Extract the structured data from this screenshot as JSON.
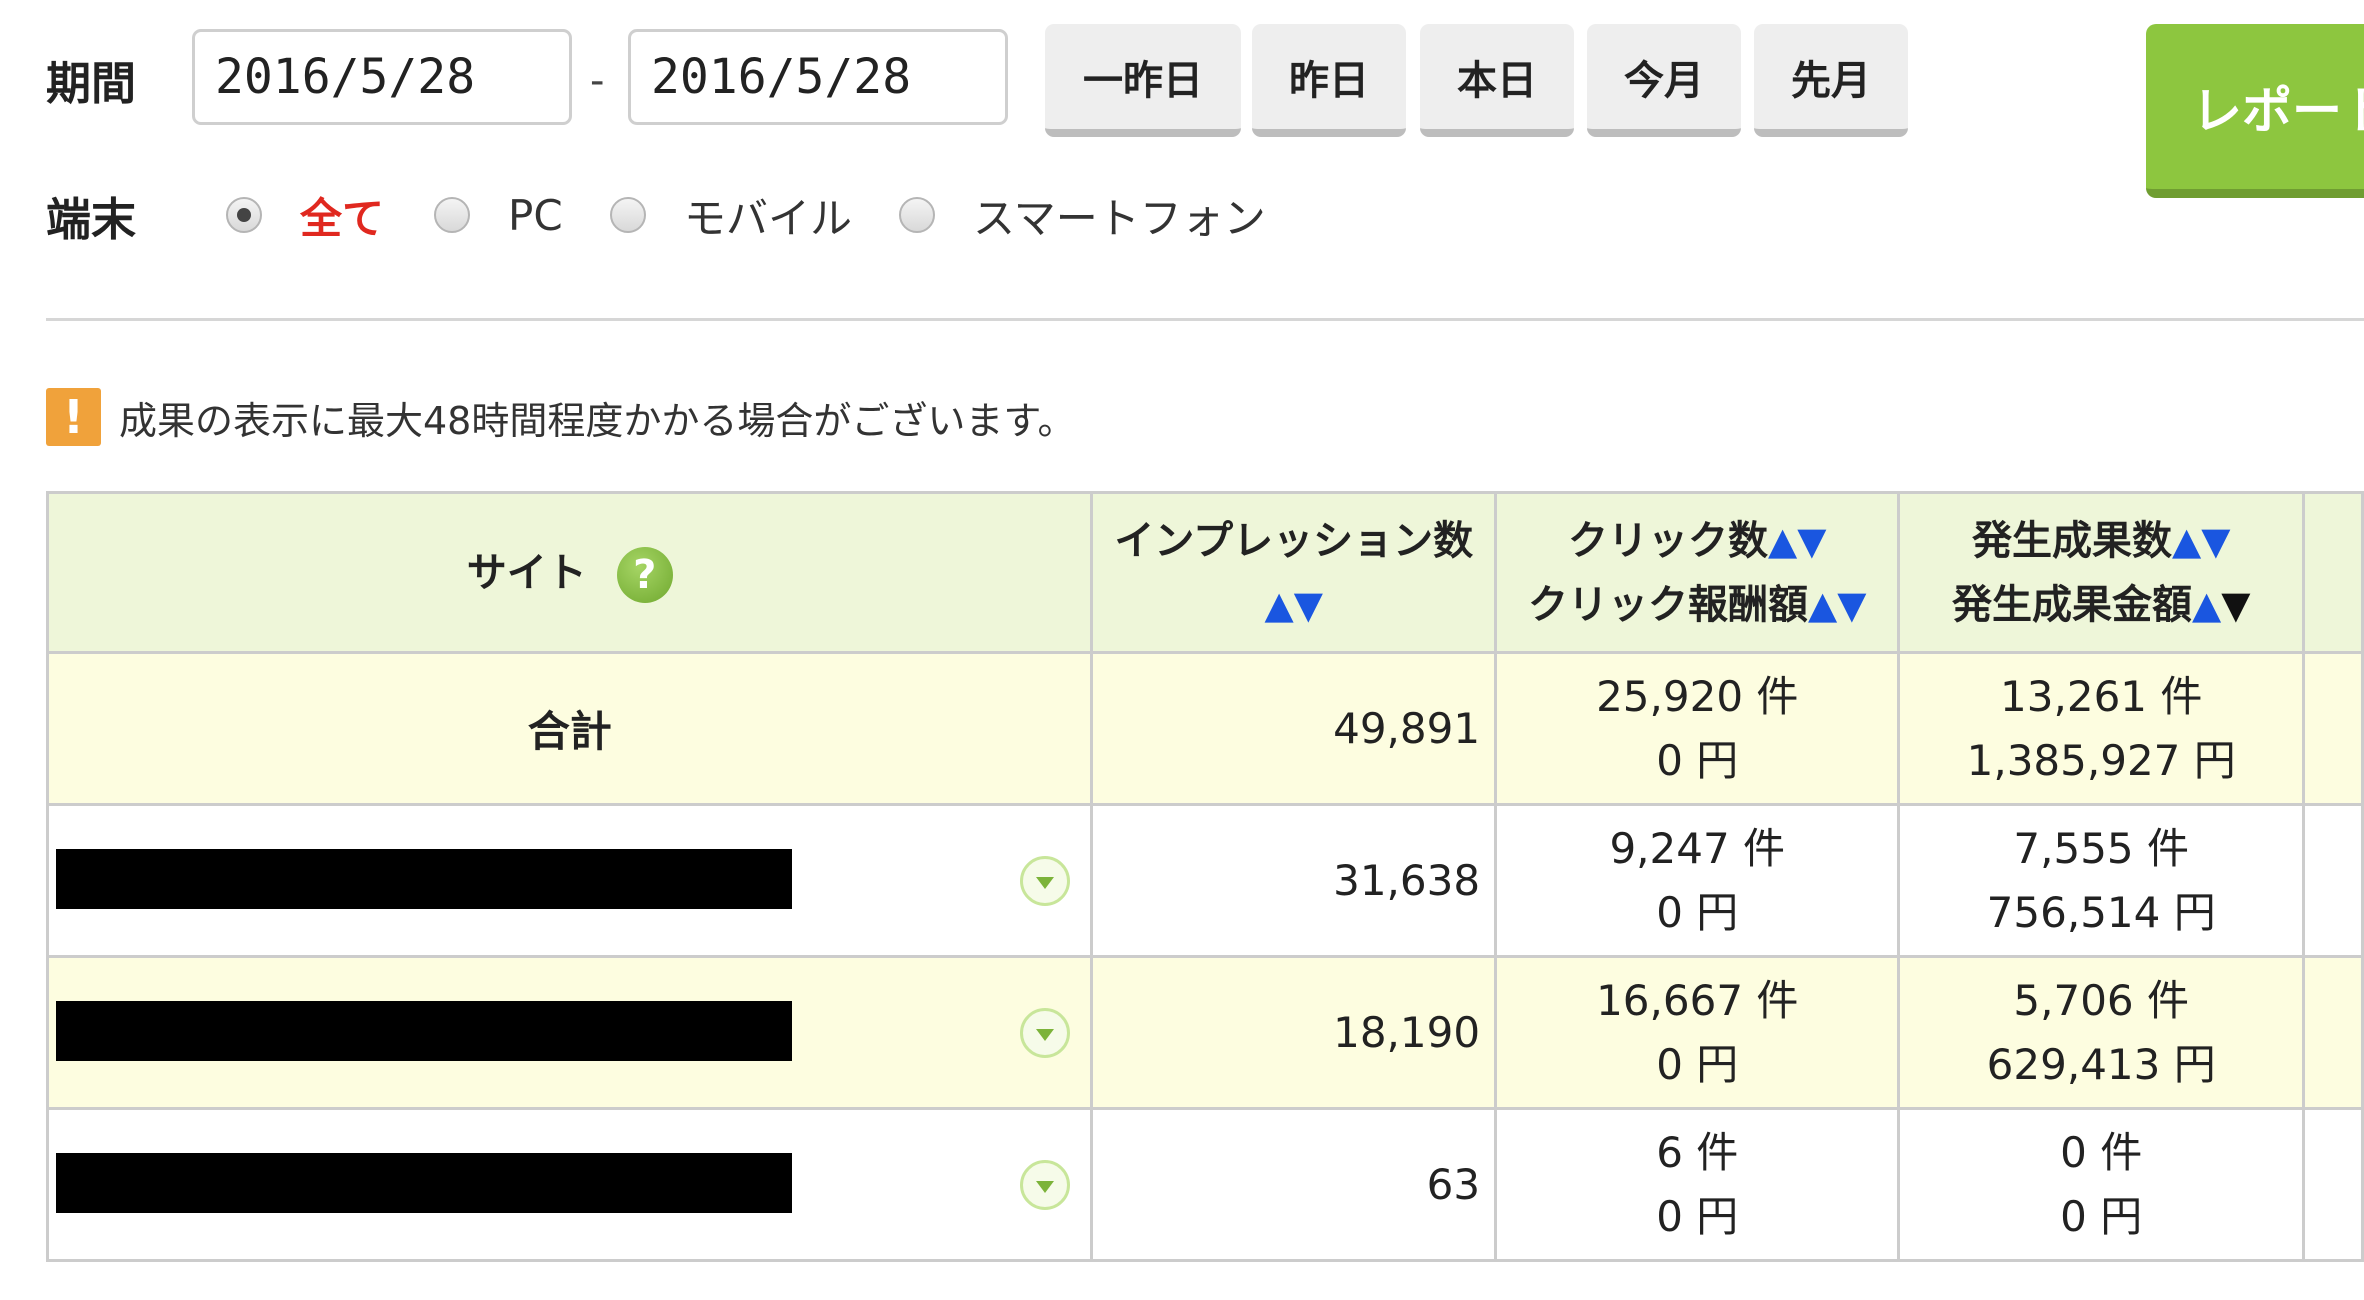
{
  "filters": {
    "period_label": "期間",
    "start_date": "2016/5/28",
    "separator": "-",
    "end_date": "2016/5/28",
    "quick_buttons": [
      "一昨日",
      "昨日",
      "本日",
      "今月",
      "先月"
    ],
    "report_button_label": "レポート",
    "device_label": "端末",
    "device_options": [
      "全て",
      "PC",
      "モバイル",
      "スマートフォン"
    ],
    "selected_device": "全て"
  },
  "notice": {
    "icon": "exclamation-icon",
    "text": "成果の表示に最大48時間程度かかる場合がございます。"
  },
  "table": {
    "headers": {
      "site": "サイト",
      "impressions": "インプレッション数",
      "clicks": "クリック数",
      "click_reward": "クリック報酬額",
      "conversions": "発生成果数",
      "conversion_amount": "発生成果金額"
    },
    "sort_arrows": {
      "up": "▲",
      "down": "▼"
    },
    "help_icon_text": "?",
    "total": {
      "label": "合計",
      "impressions": "49,891",
      "clicks": "25,920 件",
      "click_reward": "0 円",
      "conversions": "13,261 件",
      "conversion_amount": "1,385,927 円"
    },
    "rows": [
      {
        "impressions": "31,638",
        "clicks": "9,247 件",
        "click_reward": "0 円",
        "conversions": "7,555 件",
        "conversion_amount": "756,514 円"
      },
      {
        "impressions": "18,190",
        "clicks": "16,667 件",
        "click_reward": "0 円",
        "conversions": "5,706 件",
        "conversion_amount": "629,413 円"
      },
      {
        "impressions": "63",
        "clicks": "6 件",
        "click_reward": "0 円",
        "conversions": "0 件",
        "conversion_amount": "0 円"
      }
    ]
  },
  "colors": {
    "accent_green": "#8dc63f",
    "header_bg": "#eef6d9",
    "row_highlight": "#fdfde0",
    "sort_arrow": "#1a56e0",
    "active_device": "#e0281f",
    "warning": "#f0a23b"
  }
}
